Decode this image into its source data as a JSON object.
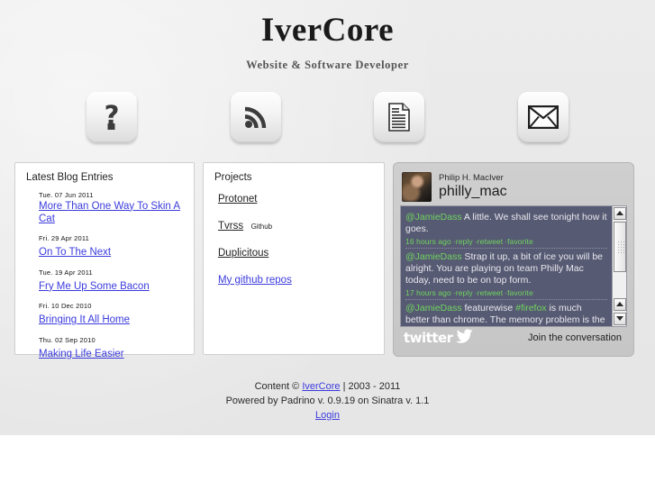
{
  "header": {
    "title": "IverCore",
    "tagline": "Website & Software Developer"
  },
  "icon_nav": [
    {
      "name": "question-mark-icon",
      "label": "About"
    },
    {
      "name": "rss-feed-icon",
      "label": "Feed"
    },
    {
      "name": "document-icon",
      "label": "Resume"
    },
    {
      "name": "envelope-icon",
      "label": "Contact"
    }
  ],
  "blog_panel": {
    "title": "Latest Blog Entries",
    "entries": [
      {
        "date": "Tue. 07 Jun 2011",
        "title": "More Than One Way To Skin A Cat"
      },
      {
        "date": "Fri. 29 Apr 2011",
        "title": "On To The Next"
      },
      {
        "date": "Tue. 19 Apr 2011",
        "title": "Fry Me Up Some Bacon"
      },
      {
        "date": "Fri. 10 Dec 2010",
        "title": "Bringing It All Home"
      },
      {
        "date": "Thu. 02 Sep 2010",
        "title": "Making Life Easier"
      }
    ]
  },
  "projects_panel": {
    "title": "Projects",
    "items": [
      {
        "name": "Protonet",
        "tag": "",
        "blue": false
      },
      {
        "name": "Tvrss",
        "tag": "Github",
        "blue": false
      },
      {
        "name": "Duplicitous",
        "tag": "",
        "blue": false
      },
      {
        "name": "My github repos",
        "tag": "",
        "blue": true
      }
    ]
  },
  "twitter": {
    "real_name": "Philip H. MacIver",
    "handle": "philly_mac",
    "tweets": [
      {
        "user": "@JamieDass",
        "body": " A little. We shall see tonight how it goes.",
        "time": "16 hours ago",
        "reply": "reply",
        "retweet": "retweet",
        "favorite": "favorite"
      },
      {
        "user": "@JamieDass",
        "body": " Strap it up, a bit of ice you will be alright. You are playing on team Philly Mac today, need to be on top form.",
        "time": "17 hours ago",
        "reply": "reply",
        "retweet": "retweet",
        "favorite": "favorite"
      },
      {
        "user": "@JamieDass",
        "body_before": " featurewise ",
        "hashtag": "#firefox",
        "body_after": " is much better than chrome. The memory problem is the only"
      }
    ],
    "logo_text": "twitter",
    "join_label": "Join the conversation"
  },
  "footer": {
    "content_prefix": "Content © ",
    "content_link": "IverCore",
    "content_suffix": " | 2003 - 2011",
    "powered_by": "Powered by Padrino v. 0.9.19 on Sinatra v. 1.1",
    "login": "Login"
  },
  "colors": {
    "page_background": "#e9e9e9",
    "link_blue": "#3b3bdd",
    "tweet_background": "#575a73",
    "tweet_accent_green": "#6fd45f"
  }
}
